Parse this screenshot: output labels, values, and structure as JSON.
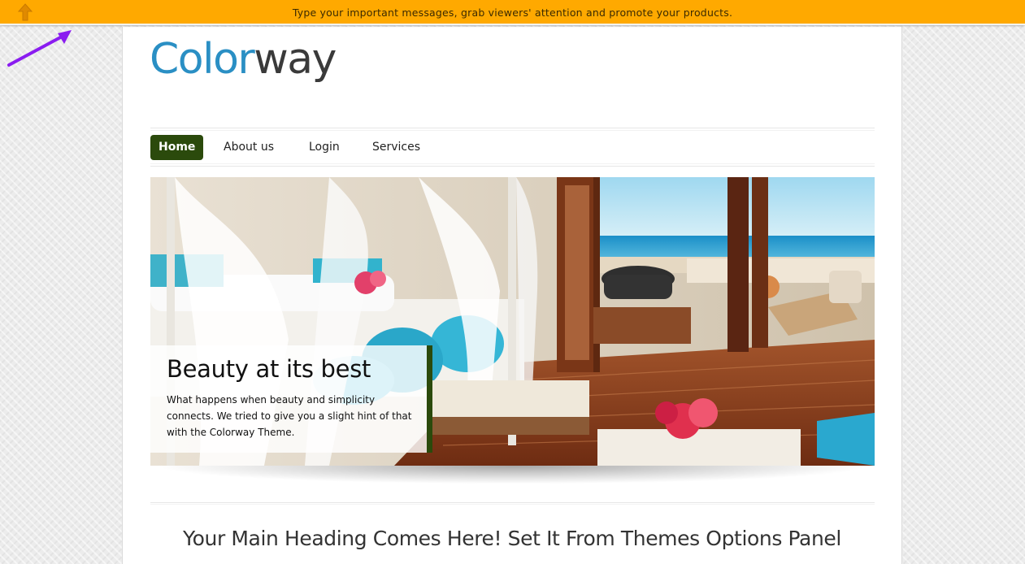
{
  "topbar": {
    "message": "Type your important messages, grab viewers' attention and promote your products.",
    "toggle_icon": "up-arrow-icon",
    "background": "#ffa900"
  },
  "annotation": {
    "icon": "pointer-arrow-icon",
    "color": "#8a1cf0"
  },
  "logo": {
    "part1": "Color",
    "part2": "way",
    "part1_color": "#2a8fc4",
    "part2_color": "#3a3a3a"
  },
  "nav": {
    "items": [
      {
        "label": "Home",
        "active": true
      },
      {
        "label": "About us",
        "active": false
      },
      {
        "label": "Login",
        "active": false
      },
      {
        "label": "Services",
        "active": false
      }
    ],
    "active_color": "#2b4a0c"
  },
  "slider": {
    "caption_title": "Beauty at its best",
    "caption_text": "What happens when beauty and simplicity connects. We tried to give you a slight hint of that with the Colorway Theme.",
    "image_description_icon": "resort-bedroom-photo"
  },
  "main": {
    "heading": "Your Main Heading Comes Here! Set It From Themes Options Panel"
  }
}
